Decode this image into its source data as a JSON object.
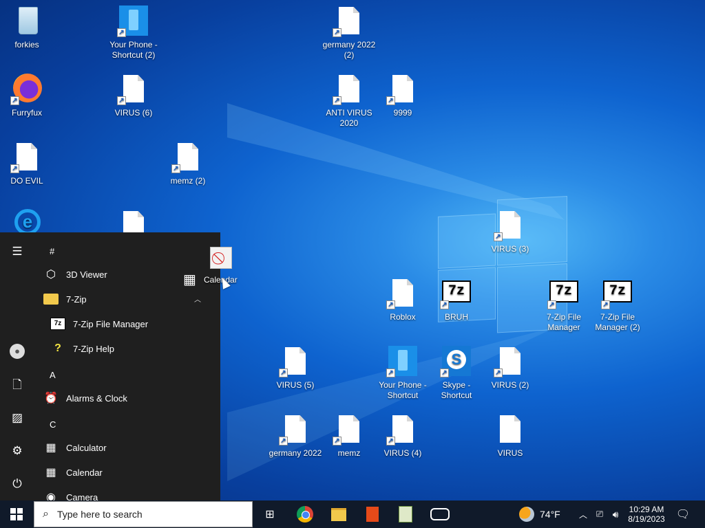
{
  "desktop_icons": {
    "recycle": "forkies",
    "your_phone_2": "Your Phone - Shortcut (2)",
    "germany_2022_2": "germany 2022 (2)",
    "furryfux": "Furryfux",
    "virus_6": "VIRUS (6)",
    "anti_virus_2020": "ANTI VIRUS 2020",
    "n9999": "9999",
    "do_evil": "DO EVIL",
    "memz_2": "memz (2)",
    "virus_3": "VIRUS (3)",
    "roblox": "Roblox",
    "bruh": "BRUH",
    "zip_fm": "7-Zip File Manager",
    "zip_fm_2": "7-Zip File Manager (2)",
    "virus_5": "VIRUS (5)",
    "your_phone": "Your Phone - Shortcut",
    "skype": "Skype - Shortcut",
    "virus_2": "VIRUS (2)",
    "germany_2022": "germany 2022",
    "memz": "memz",
    "virus_4": "VIRUS (4)",
    "virus": "VIRUS"
  },
  "start_menu": {
    "headers": [
      "#",
      "A",
      "C"
    ],
    "apps": {
      "viewer3d": "3D Viewer",
      "zip": "7-Zip",
      "zip_fm": "7-Zip File Manager",
      "zip_help": "7-Zip Help",
      "alarms": "Alarms & Clock",
      "calculator": "Calculator",
      "calendar": "Calendar",
      "camera": "Camera"
    }
  },
  "drag_ghost": {
    "label": "Calendar"
  },
  "taskbar": {
    "search_placeholder": "Type here to search",
    "weather": "74°F",
    "time": "10:29 AM",
    "date": "8/19/2023"
  }
}
